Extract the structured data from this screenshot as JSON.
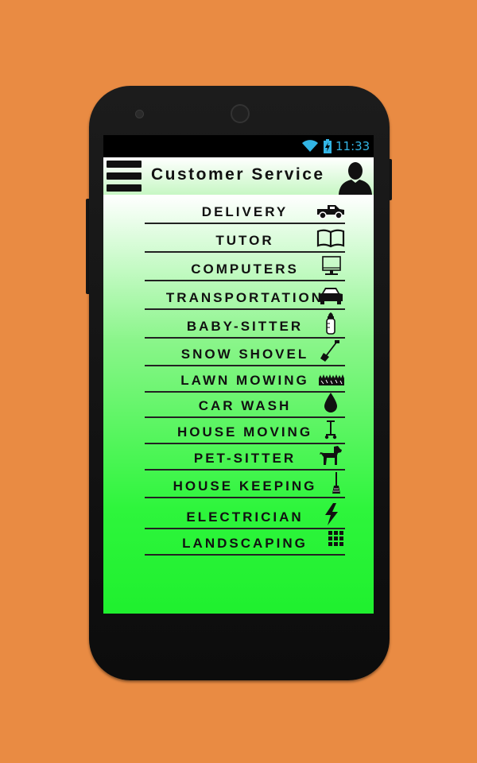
{
  "status_bar": {
    "time": "11:33",
    "wifi_icon": "wifi-icon",
    "battery_icon": "battery-charging-icon",
    "accent_color": "#33B5E5"
  },
  "app_bar": {
    "title": "Customer Service",
    "menu_icon": "hamburger-menu-icon",
    "avatar_icon": "user-silhouette-icon"
  },
  "colors": {
    "background": "#E98B43",
    "list_gradient_top": "#ffffff",
    "list_gradient_bottom": "#1ff02e"
  },
  "services": [
    {
      "label": "DELIVERY",
      "icon": "pickup-truck-icon"
    },
    {
      "label": "TUTOR",
      "icon": "open-book-icon"
    },
    {
      "label": "COMPUTERS",
      "icon": "monitor-icon"
    },
    {
      "label": "TRANSPORTATION",
      "icon": "car-icon"
    },
    {
      "label": "BABY-SITTER",
      "icon": "baby-bottle-icon"
    },
    {
      "label": "SNOW SHOVEL",
      "icon": "shovel-icon"
    },
    {
      "label": "LAWN MOWING",
      "icon": "grass-icon"
    },
    {
      "label": "CAR WASH",
      "icon": "water-drop-icon"
    },
    {
      "label": "HOUSE MOVING",
      "icon": "hand-truck-icon"
    },
    {
      "label": "PET-SITTER",
      "icon": "dog-icon"
    },
    {
      "label": "HOUSE KEEPING",
      "icon": "broom-icon"
    },
    {
      "label": "ELECTRICIAN",
      "icon": "lightning-bolt-icon"
    },
    {
      "label": "LANDSCAPING",
      "icon": "tile-grid-icon"
    }
  ]
}
